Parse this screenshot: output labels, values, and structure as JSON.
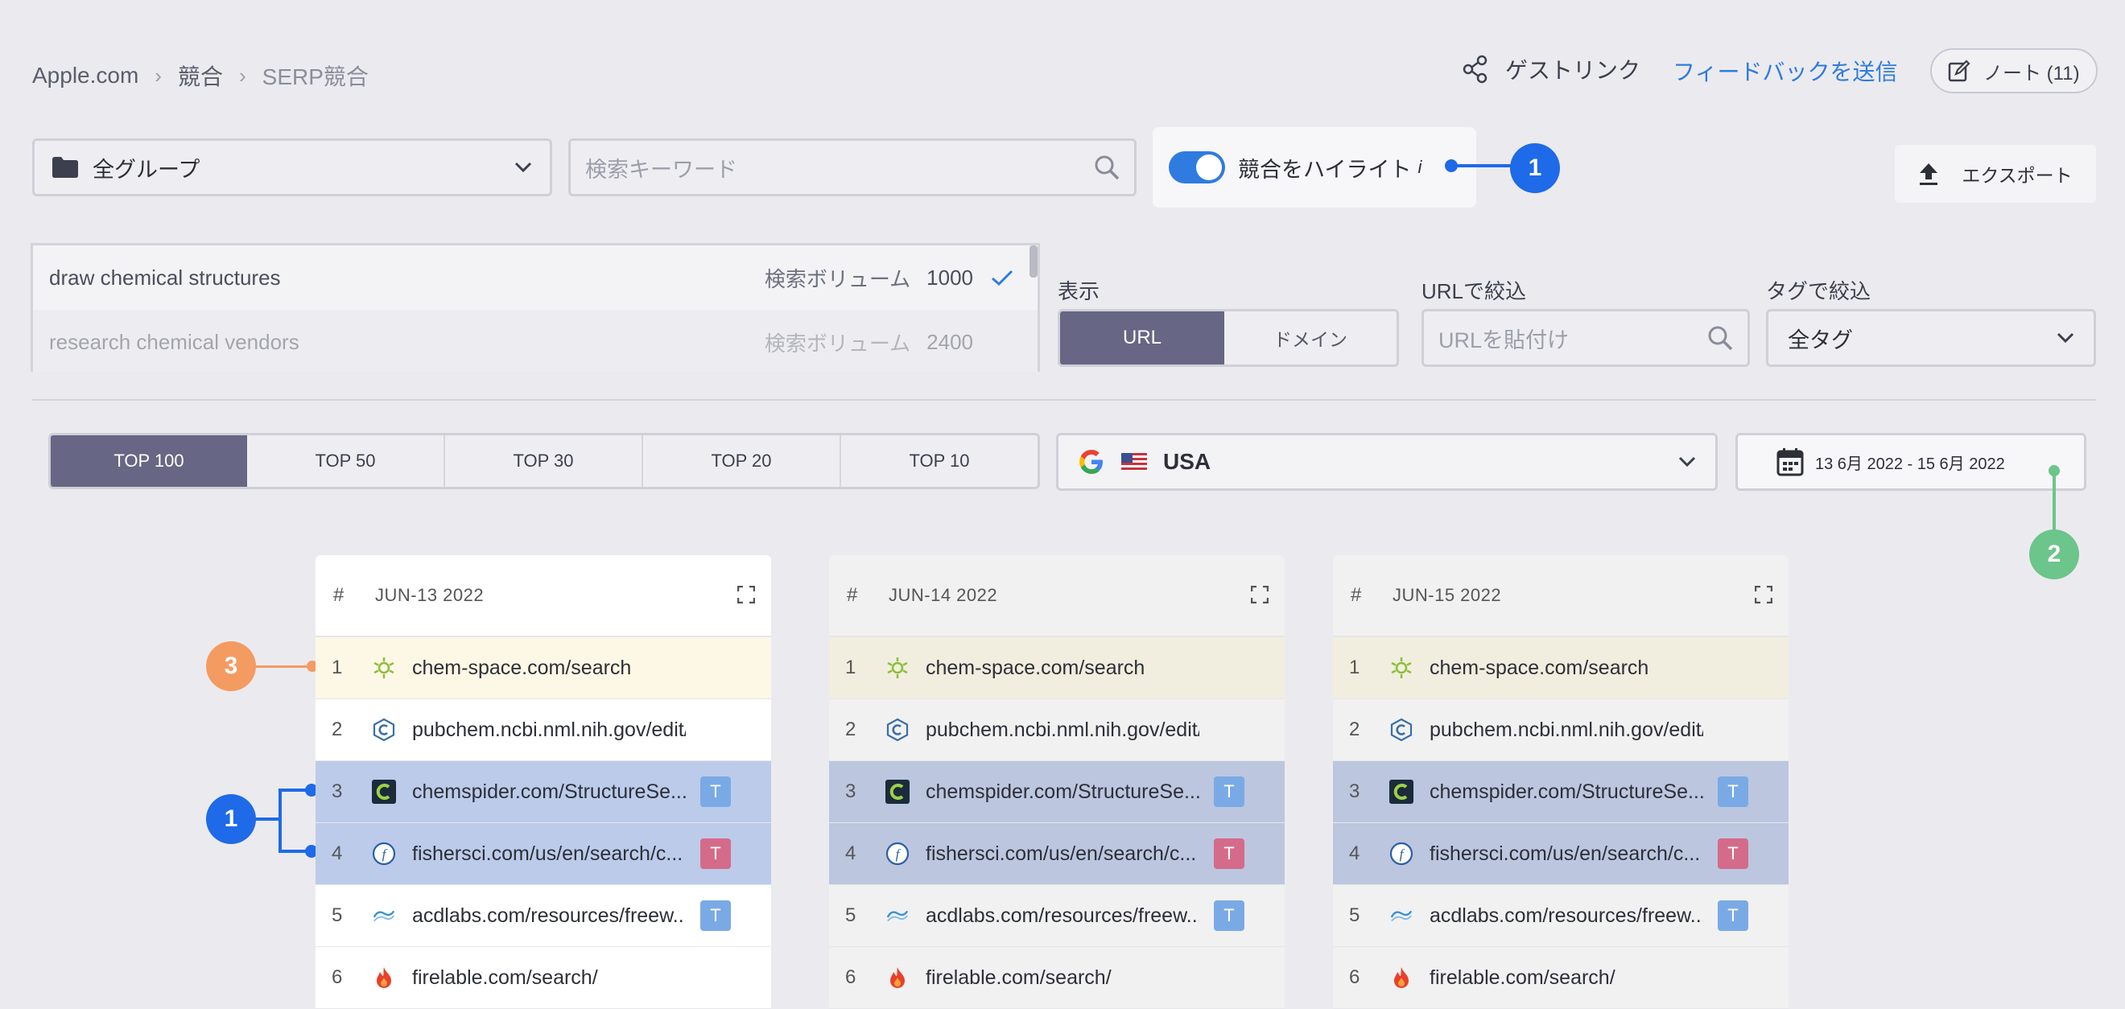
{
  "breadcrumb": {
    "items": [
      "Apple.com",
      "競合",
      "SERP競合"
    ]
  },
  "header": {
    "guest_link": "ゲストリンク",
    "feedback": "フィードバックを送信",
    "notes": "ノート (11)"
  },
  "filters": {
    "group_value": "全グループ",
    "keyword_placeholder": "検索キーワード",
    "highlight_label": "競合をハイライト",
    "highlight_info": "i",
    "export": "エクスポート"
  },
  "keywords": [
    {
      "text": "draw chemical structures",
      "volume_label": "検索ボリューム",
      "volume": "1000"
    },
    {
      "text": "research chemical vendors",
      "volume_label": "検索ボリューム",
      "volume": "2400"
    }
  ],
  "view": {
    "label": "表示",
    "url": "URL",
    "domain": "ドメイン"
  },
  "url_filter": {
    "label": "URLで絞込",
    "placeholder": "URLを貼付け"
  },
  "tag_filter": {
    "label": "タグで絞込",
    "value": "全タグ"
  },
  "top_tabs": [
    "TOP 100",
    "TOP 50",
    "TOP 30",
    "TOP 20",
    "TOP 10"
  ],
  "location": {
    "country": "USA"
  },
  "date_range": "13 6月 2022 - 15 6月 2022",
  "badges": {
    "b1": "1",
    "b2": "2",
    "b3": "3"
  },
  "tables": [
    {
      "hash": "#",
      "date": "JUN-13 2022"
    },
    {
      "hash": "#",
      "date": "JUN-14 2022"
    },
    {
      "hash": "#",
      "date": "JUN-15 2022"
    }
  ],
  "rows": [
    {
      "n": "1",
      "url": "chem-space.com/search",
      "icon": "chem-space-icon",
      "tag": ""
    },
    {
      "n": "2",
      "url": "pubchem.ncbi.nml.nih.gov/edit/",
      "icon": "pubchem-icon",
      "tag": ""
    },
    {
      "n": "3",
      "url": "chemspider.com/StructureSe...",
      "icon": "chemspider-icon",
      "tag": "T"
    },
    {
      "n": "4",
      "url": "fishersci.com/us/en/search/c...",
      "icon": "fishersci-icon",
      "tag": "T"
    },
    {
      "n": "5",
      "url": "acdlabs.com/resources/freew...",
      "icon": "acdlabs-icon",
      "tag": "T"
    },
    {
      "n": "6",
      "url": "firelable.com/search/",
      "icon": "fire-icon",
      "tag": ""
    }
  ],
  "colors": {
    "accent": "#2f7be0",
    "badge_blue": "#1e6ae8",
    "badge_green": "#6cc58b",
    "badge_orange": "#f49b62",
    "segment_active": "#676684"
  }
}
